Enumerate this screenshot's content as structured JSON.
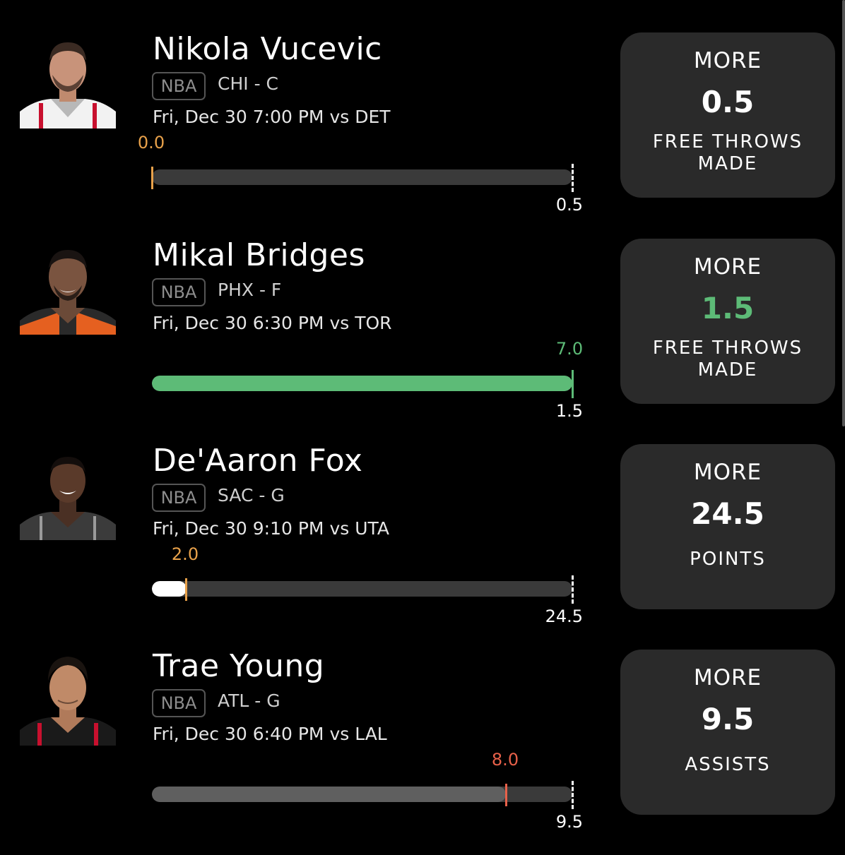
{
  "colors": {
    "over_green": "#5dbb77",
    "current_orange": "#e8a14a",
    "current_red": "#e8614a",
    "track": "#3a3a3a",
    "card_bg": "#2a2a2a"
  },
  "picks": [
    {
      "name": "Nikola Vucevic",
      "league": "NBA",
      "team_pos": "CHI - C",
      "game": "Fri, Dec 30 7:00 PM  vs DET",
      "current": "0.0",
      "goal": "0.5",
      "progress": 0.0,
      "choice": "MORE",
      "line": "0.5",
      "stat_line1": "FREE THROWS",
      "stat_line2": "MADE",
      "jersey_color": "#c8102e",
      "jersey_icon": "bulls-jersey-icon"
    },
    {
      "name": "Mikal Bridges",
      "league": "NBA",
      "team_pos": "PHX - F",
      "game": "Fri, Dec 30 6:30 PM  vs TOR",
      "current": "7.0",
      "goal": "1.5",
      "progress": 1.0,
      "choice": "MORE",
      "line": "1.5",
      "stat_line1": "FREE THROWS",
      "stat_line2": "MADE",
      "jersey_color": "#e56020",
      "jersey_icon": "suns-jersey-icon"
    },
    {
      "name": "De'Aaron Fox",
      "league": "NBA",
      "team_pos": "SAC - G",
      "game": "Fri, Dec 30 9:10 PM  vs UTA",
      "current": "2.0",
      "goal": "24.5",
      "progress": 0.082,
      "choice": "MORE",
      "line": "24.5",
      "stat_line1": "POINTS",
      "stat_line2": "",
      "jersey_color": "#3b3b3b",
      "jersey_icon": "kings-jersey-icon"
    },
    {
      "name": "Trae Young",
      "league": "NBA",
      "team_pos": "ATL - G",
      "game": "Fri, Dec 30 6:40 PM  vs LAL",
      "current": "8.0",
      "goal": "9.5",
      "progress": 0.842,
      "choice": "MORE",
      "line": "9.5",
      "stat_line1": "ASSISTS",
      "stat_line2": "",
      "jersey_color": "#7a1a1a",
      "jersey_icon": "hawks-jersey-icon"
    }
  ]
}
